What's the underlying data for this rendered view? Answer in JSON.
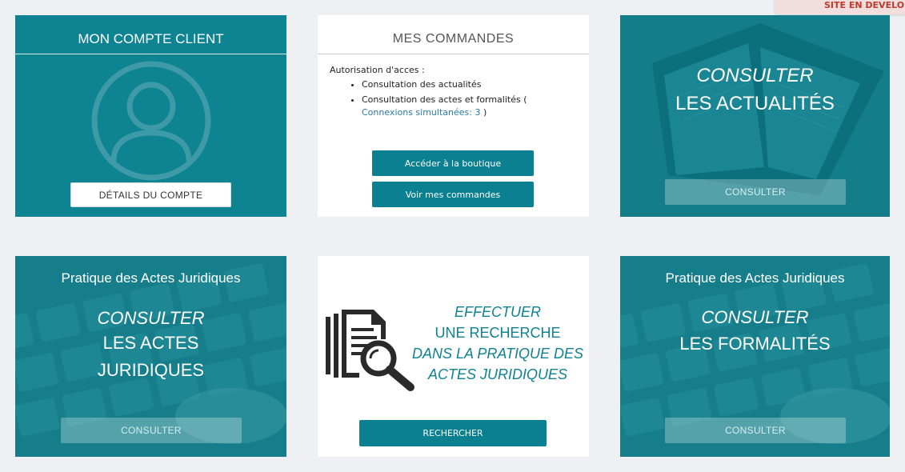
{
  "banner": {
    "text": "SITE EN DEVELOP"
  },
  "account": {
    "title": "MON COMPTE CLIENT",
    "details_button": "DÉTAILS DU COMPTE"
  },
  "orders": {
    "title": "MES COMMANDES",
    "auth_label": "Autorisation d'acces :",
    "item1": "Consultation des actualités",
    "item2_prefix": "Consultation des actes et formalités (",
    "item2_link": "Connexions simultanées: 3",
    "item2_suffix": ")",
    "shop_button": "Accéder à la boutique",
    "orders_button": "Voir mes commandes"
  },
  "news": {
    "line1": "CONSULTER",
    "line2": "LES ACTUALITÉS",
    "button": "CONSULTER"
  },
  "actes": {
    "header": "Pratique des Actes Juridiques",
    "line1": "CONSULTER",
    "line2": "LES ACTES",
    "line3": "JURIDIQUES",
    "button": "CONSULTER"
  },
  "search": {
    "line1": "EFFECTUER",
    "line2": "UNE RECHERCHE",
    "line3": "DANS LA PRATIQUE DES",
    "line4": "ACTES JURIDIQUES",
    "button": "RECHERCHER"
  },
  "formalites": {
    "header": "Pratique des Actes Juridiques",
    "line1": "CONSULTER",
    "line2": "LES FORMALITÉS",
    "button": "CONSULTER"
  },
  "icons": [
    "user-avatar-icon",
    "document-search-icon"
  ],
  "colors": {
    "teal": "#0e8391",
    "background": "#eef0f3",
    "link": "#2b7aa8",
    "banner_text": "#c0392b"
  }
}
